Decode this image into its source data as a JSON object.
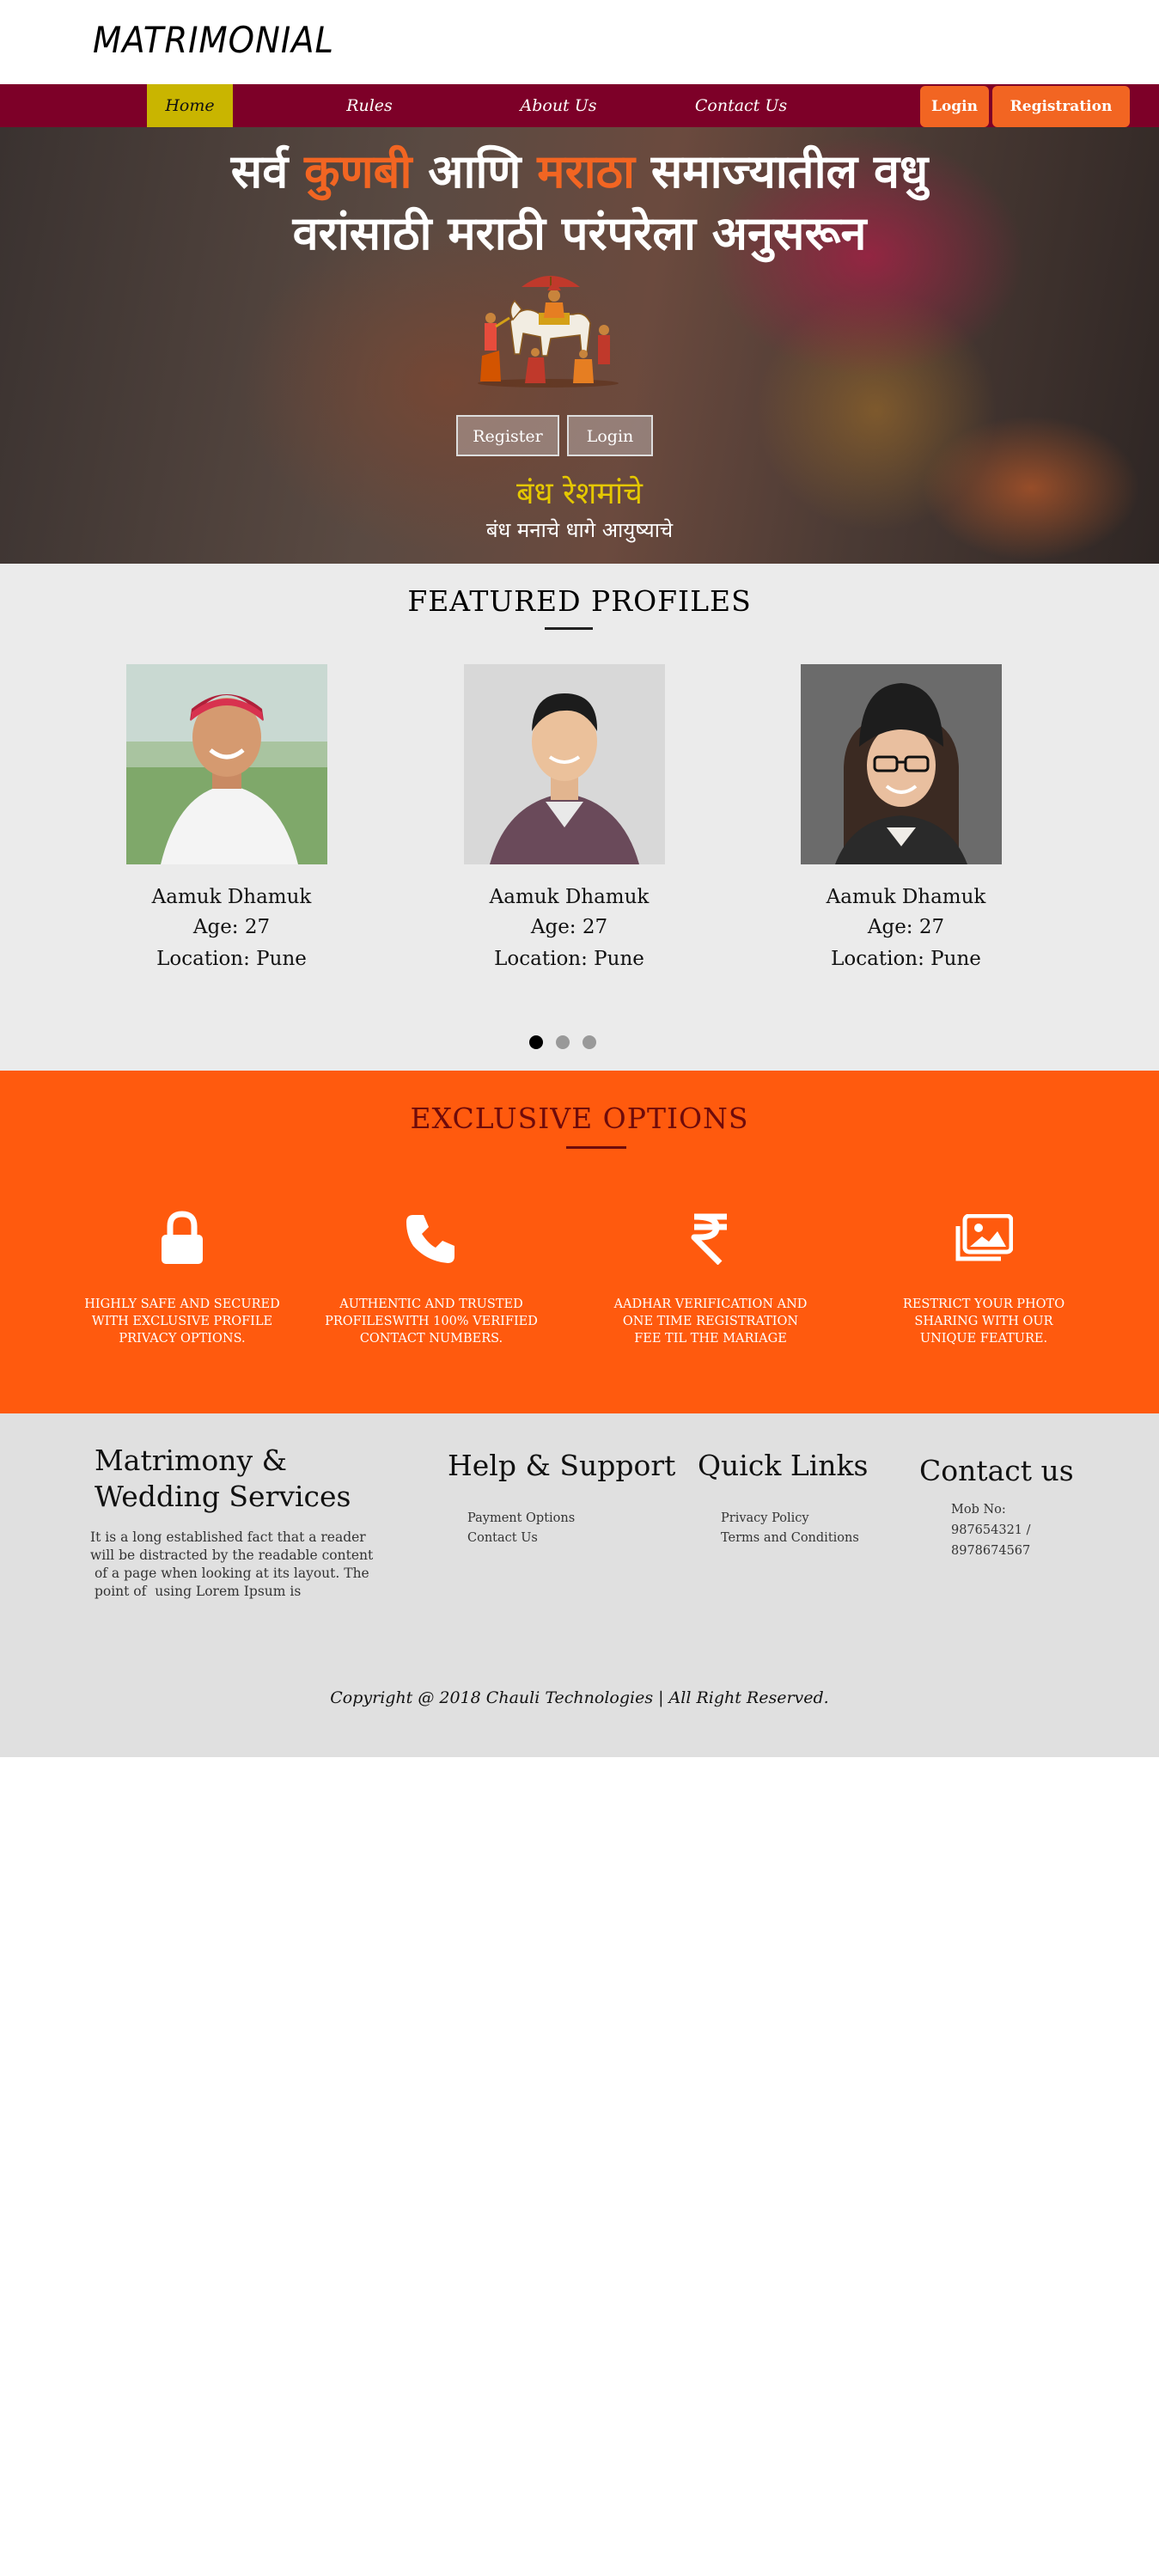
{
  "header": {
    "logo": "MATRIMONIAL"
  },
  "nav": {
    "items": [
      "Home",
      "Rules",
      "About Us",
      "Contact Us"
    ],
    "login": "Login",
    "registration": "Registration"
  },
  "hero": {
    "line1_part1": "सर्व ",
    "line1_highlight1": "कुणबी",
    "line1_part2": " आणि ",
    "line1_highlight2": "मराठा",
    "line1_part3": " समाज्यातील वधु",
    "line2": "वरांसाठी मराठी परंपरेला अनुसरून",
    "register_button": "Register",
    "login_button": "Login",
    "tagline": "बंध रेशमांचे",
    "subtagline": "बंध मनाचे धागे आयुष्याचे"
  },
  "featured": {
    "title": "FEATURED PROFILES",
    "profiles": [
      {
        "name": "Aamuk Dhamuk",
        "age": "Age: 27",
        "location": "Location: Pune"
      },
      {
        "name": "Aamuk Dhamuk",
        "age": "Age: 27",
        "location": "Location: Pune"
      },
      {
        "name": "Aamuk Dhamuk",
        "age": "Age: 27",
        "location": "Location: Pune"
      }
    ]
  },
  "exclusive": {
    "title": "EXCLUSIVE OPTIONS",
    "features": [
      {
        "icon": "lock-icon",
        "text": "HIGHLY SAFE AND SECURED\nWITH EXCLUSIVE PROFILE\nPRIVACY OPTIONS."
      },
      {
        "icon": "phone-icon",
        "text": "AUTHENTIC AND TRUSTED\nPROFILESWITH 100% VERIFIED\nCONTACT NUMBERS."
      },
      {
        "icon": "rupee-icon",
        "text": "AADHAR VERIFICATION AND\nONE TIME REGISTRATION\nFEE TIL THE MARIAGE"
      },
      {
        "icon": "photos-icon",
        "text": "RESTRICT YOUR PHOTO\nSHARING WITH OUR\nUNIQUE FEATURE."
      }
    ]
  },
  "footer": {
    "services_title": "Matrimony & Wedding Services",
    "services_text": "It is a long established fact that a reader\nwill be distracted by the readable content\n of a page when looking at its layout. The\n point of  using Lorem Ipsum is",
    "help_title": "Help & Support",
    "help_links": [
      "Payment Options",
      "Contact Us"
    ],
    "quick_title": "Quick Links",
    "quick_links": [
      "Privacy Policy",
      "Terms and Conditions"
    ],
    "contact_title": "Contact us",
    "contact_lines": [
      "Mob No:",
      "987654321 /",
      "8978674567"
    ],
    "copyright": "Copyright @ 2018 Chauli Technologies | All Right Reserved."
  },
  "colors": {
    "nav_bg": "#7d0028",
    "nav_active": "#c9b500",
    "accent": "#f26522",
    "exclusive_bg": "#ff5a0e",
    "exclusive_title": "#6e0b0b",
    "tagline": "#e5c800"
  }
}
